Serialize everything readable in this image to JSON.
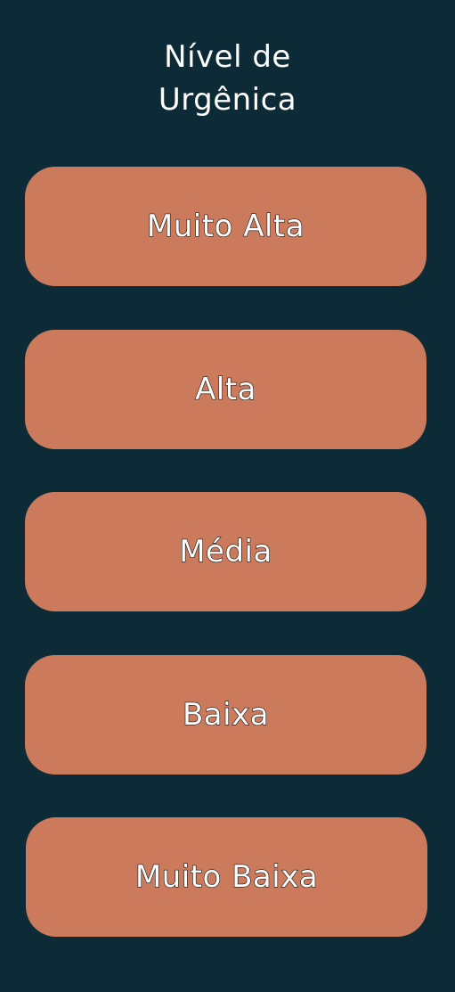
{
  "header": {
    "title_line1": "Nível de",
    "title_line2": "Urgênica"
  },
  "urgency_levels": [
    {
      "label": "Muito Alta"
    },
    {
      "label": "Alta"
    },
    {
      "label": "Média"
    },
    {
      "label": "Baixa"
    },
    {
      "label": "Muito Baixa"
    }
  ],
  "colors": {
    "background": "#0d2b36",
    "button": "#cb7b5b",
    "text": "#ffffff"
  }
}
